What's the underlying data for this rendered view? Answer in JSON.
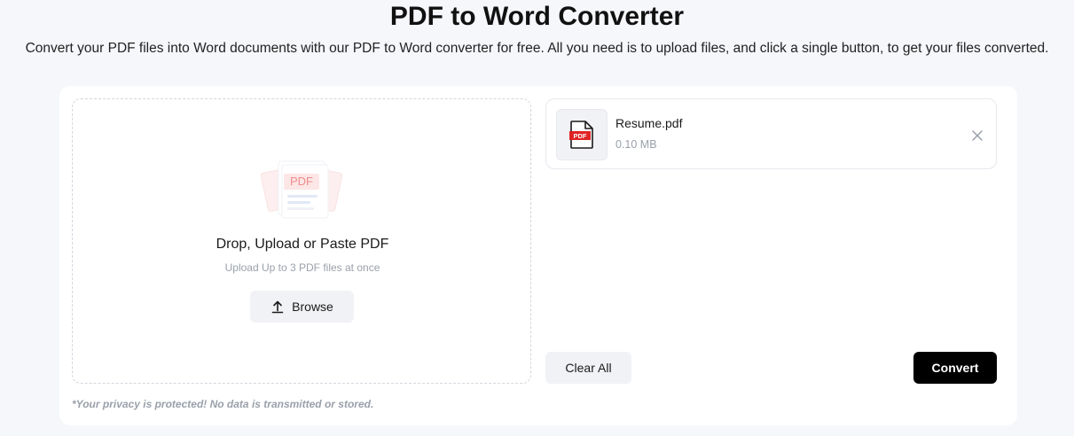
{
  "header": {
    "title": "PDF to Word Converter",
    "subtitle": "Convert your PDF files into Word documents with our PDF to Word converter for free. All you need is to upload files, and click a single button, to get your files converted."
  },
  "dropzone": {
    "illustration_text": "PDF",
    "title": "Drop, Upload or Paste PDF",
    "hint": "Upload Up to 3 PDF files at once",
    "browse_label": "Browse",
    "browse_icon": "upload-icon"
  },
  "files": [
    {
      "name": "Resume.pdf",
      "size": "0.10 MB",
      "icon": "pdf-file-icon",
      "badge": "PDF"
    }
  ],
  "actions": {
    "clear_label": "Clear All",
    "convert_label": "Convert"
  },
  "footer": {
    "privacy_note": "*Your privacy is protected! No data is transmitted or stored."
  },
  "colors": {
    "background": "#f6f7fb",
    "card": "#ffffff",
    "primary_button": "#000000",
    "secondary_button": "#f1f2f5",
    "pdf_red": "#e02424"
  }
}
